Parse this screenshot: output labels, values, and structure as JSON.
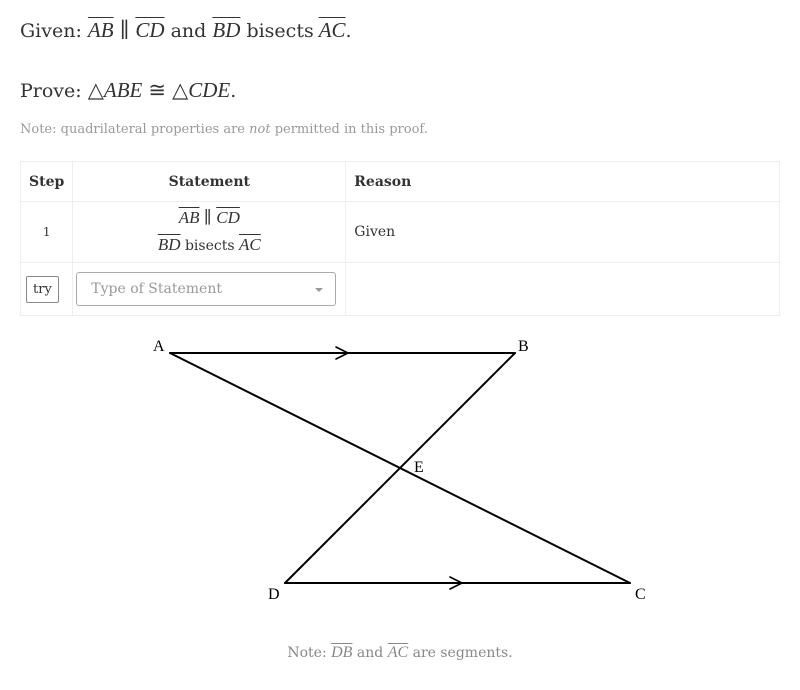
{
  "given": {
    "label": "Given:",
    "seg1": "AB",
    "parallel": "∥",
    "seg2": "CD",
    "and": "and",
    "seg3": "BD",
    "bisects": "bisects",
    "seg4": "AC",
    "end": "."
  },
  "prove": {
    "label": "Prove:",
    "tri1": "ABE",
    "congruent": "≅",
    "tri2": "CDE",
    "end": "."
  },
  "note_top": {
    "prefix": "Note: quadrilateral properties are ",
    "emph": "not",
    "suffix": " permitted in this proof."
  },
  "table": {
    "headers": {
      "step": "Step",
      "statement": "Statement",
      "reason": "Reason"
    },
    "rows": [
      {
        "step": "1",
        "statement_line1": {
          "seg1": "AB",
          "parallel": "∥",
          "seg2": "CD"
        },
        "statement_line2": {
          "seg1": "BD",
          "word": "bisects",
          "seg2": "AC"
        },
        "reason": "Given"
      }
    ],
    "try_label": "try",
    "statement_placeholder": "Type of Statement"
  },
  "figure": {
    "labels": {
      "A": "A",
      "B": "B",
      "C": "C",
      "D": "D",
      "E": "E"
    },
    "parallel_marks": [
      "AB",
      "DC"
    ]
  },
  "note_bottom": {
    "prefix": "Note:",
    "seg1": "DB",
    "and": "and",
    "seg2": "AC",
    "suffix": "are segments."
  }
}
